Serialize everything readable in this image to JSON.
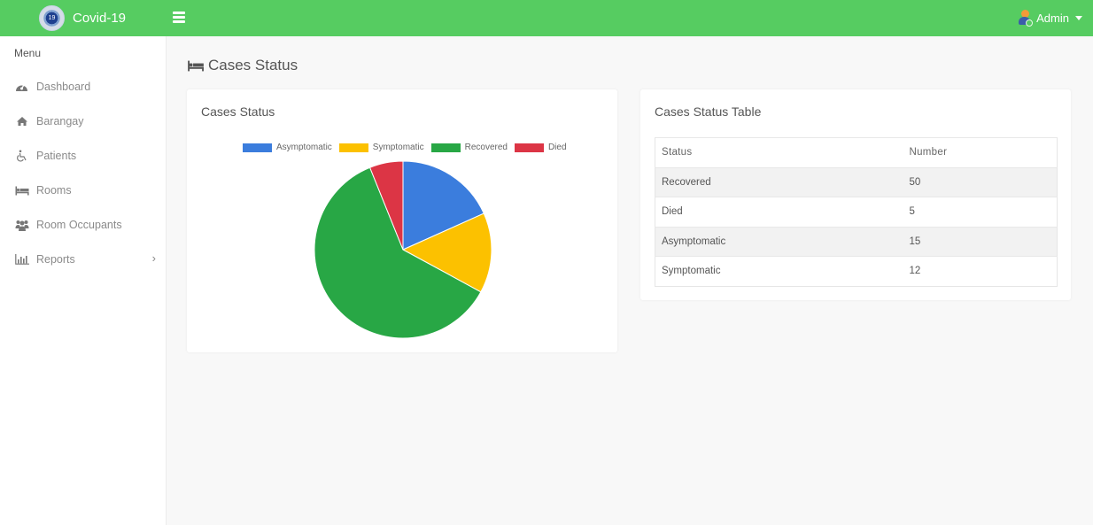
{
  "header": {
    "brand": "Covid-19",
    "logo_text": "19",
    "user": "Admin",
    "color": "#56cc61"
  },
  "sidebar": {
    "menu_label": "Menu",
    "items": [
      {
        "label": "Dashboard",
        "icon": "tachometer-icon"
      },
      {
        "label": "Barangay",
        "icon": "home-icon"
      },
      {
        "label": "Patients",
        "icon": "wheelchair-icon"
      },
      {
        "label": "Rooms",
        "icon": "bed-icon"
      },
      {
        "label": "Room Occupants",
        "icon": "users-icon"
      },
      {
        "label": "Reports",
        "icon": "bar-chart-icon",
        "has_submenu": true
      }
    ]
  },
  "page": {
    "title": "Cases Status"
  },
  "chart_card": {
    "title": "Cases Status"
  },
  "table_card": {
    "title": "Cases Status Table",
    "columns": [
      "Status",
      "Number"
    ],
    "rows": [
      [
        "Recovered",
        "50"
      ],
      [
        "Died",
        "5"
      ],
      [
        "Asymptomatic",
        "15"
      ],
      [
        "Symptomatic",
        "12"
      ]
    ]
  },
  "chart_data": {
    "type": "pie",
    "title": "",
    "legend_position": "top",
    "categories": [
      "Asymptomatic",
      "Symptomatic",
      "Recovered",
      "Died"
    ],
    "values": [
      15,
      12,
      50,
      5
    ],
    "colors": [
      "#3b7ddd",
      "#fcc100",
      "#28a745",
      "#dc3545"
    ]
  }
}
